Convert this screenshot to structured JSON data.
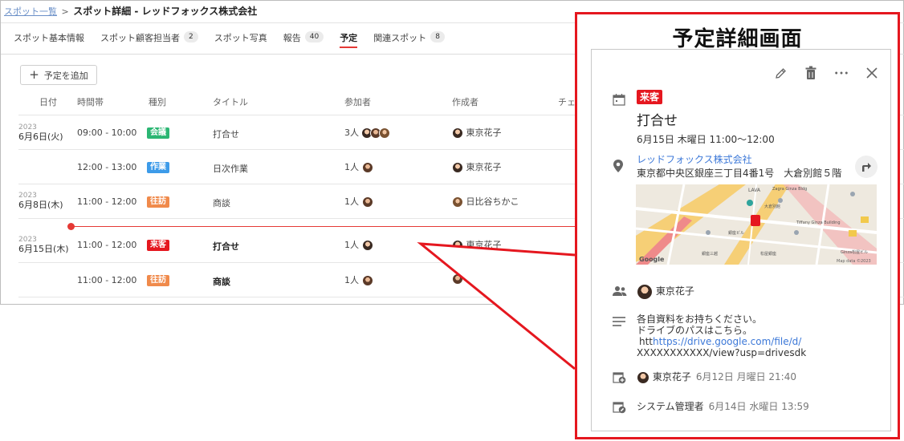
{
  "breadcrumb": {
    "parent": "スポット一覧",
    "separator": ">",
    "current": "スポット詳細 - レッドフォックス株式会社"
  },
  "tabs": [
    {
      "label": "スポット基本情報",
      "count": null,
      "active": false
    },
    {
      "label": "スポット顧客担当者",
      "count": "2",
      "active": false
    },
    {
      "label": "スポット写真",
      "count": null,
      "active": false
    },
    {
      "label": "報告",
      "count": "40",
      "active": false
    },
    {
      "label": "予定",
      "count": null,
      "active": true
    },
    {
      "label": "関連スポット",
      "count": "8",
      "active": false
    }
  ],
  "toolbar": {
    "add_label": "予定を追加",
    "add_icon": "plus-icon"
  },
  "table": {
    "headers": [
      "日付",
      "時間帯",
      "種別",
      "タイトル",
      "参加者",
      "作成者",
      "チェ"
    ],
    "rows": [
      {
        "year": "2023",
        "day": "6月6日(火)",
        "time": "09:00 - 10:00",
        "type": "会議",
        "type_color": "#2bb673",
        "title": "打合せ",
        "participants": "3人",
        "creator": "東京花子",
        "bold": false
      },
      {
        "year": "",
        "day": "",
        "time": "12:00 - 13:00",
        "type": "作業",
        "type_color": "#3d9be9",
        "title": "日次作業",
        "participants": "1人",
        "creator": "東京花子",
        "bold": false
      },
      {
        "year": "2023",
        "day": "6月8日(木)",
        "time": "11:00 - 12:00",
        "type": "往訪",
        "type_color": "#f08a4b",
        "title": "商談",
        "participants": "1人",
        "creator": "日比谷ちかこ",
        "bold": false
      },
      {
        "year": "2023",
        "day": "6月15日(木)",
        "time": "11:00 - 12:00",
        "type": "来客",
        "type_color": "#e5171f",
        "title": "打合せ",
        "participants": "1人",
        "creator": "東京花子",
        "bold": true
      },
      {
        "year": "",
        "day": "",
        "time": "11:00 - 12:00",
        "type": "往訪",
        "type_color": "#f08a4b",
        "title": "商談",
        "participants": "1人",
        "creator": "",
        "bold": true
      }
    ]
  },
  "callout": {
    "title": "予定詳細画面",
    "actions": [
      "pencil-icon",
      "trash-icon",
      "more-icon",
      "close-icon"
    ],
    "type_badge": "来客",
    "event_title": "打合せ",
    "when": "6月15日 木曜日 11:00〜12:00",
    "location_name": "レッドフォックス株式会社",
    "location_address": "東京都中央区銀座三丁目4番1号　大倉別館５階",
    "map": {
      "labels": [
        "LAVA",
        "Zagra Ginza Bldg",
        "大倉別館",
        "銀座ビル",
        "Tiffany Ginza Building",
        "Ginza松屋ビル",
        "松屋銀座",
        "銀座三越"
      ],
      "credit": "Map data ©2023",
      "logo": "Google"
    },
    "participant": "東京花子",
    "notes": "各自資料をお持ちください。\nドライブのパスはこちら。",
    "notes_link_prefix": "htt",
    "notes_link": "https://drive.google.com/file/d/",
    "notes_link_tail": "XXXXXXXXXXX/view?usp=drivesdk",
    "created_by": "東京花子",
    "created_at": "6月12日 月曜日 21:40",
    "updated_by": "システム管理者",
    "updated_at": "6月14日 水曜日 13:59"
  }
}
